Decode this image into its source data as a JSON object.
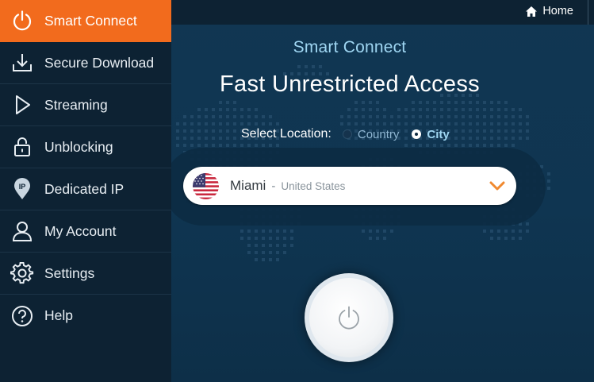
{
  "sidebar": {
    "items": [
      {
        "label": "Smart Connect",
        "icon": "power-icon",
        "active": true
      },
      {
        "label": "Secure Download",
        "icon": "download-icon"
      },
      {
        "label": "Streaming",
        "icon": "play-icon"
      },
      {
        "label": "Unblocking",
        "icon": "lock-icon"
      },
      {
        "label": "Dedicated IP",
        "icon": "ip-pin-icon"
      },
      {
        "label": "My Account",
        "icon": "user-icon"
      },
      {
        "label": "Settings",
        "icon": "gear-icon"
      },
      {
        "label": "Help",
        "icon": "help-icon"
      }
    ]
  },
  "topbar": {
    "home_label": "Home",
    "home_icon": "home-icon"
  },
  "main": {
    "subtitle": "Smart Connect",
    "title": "Fast Unrestricted Access",
    "location": {
      "label": "Select Location:",
      "options": [
        {
          "label": "Country",
          "checked": false
        },
        {
          "label": "City",
          "checked": true
        }
      ]
    },
    "selected": {
      "city": "Miami",
      "separator": "-",
      "country": "United States",
      "flag": "us-flag-icon"
    },
    "power_button": {
      "icon": "power-icon"
    }
  },
  "colors": {
    "accent": "#f26b1d",
    "sidebar_bg": "#0d2233",
    "main_bg": "#113652",
    "subtitle": "#9fd6f2"
  }
}
